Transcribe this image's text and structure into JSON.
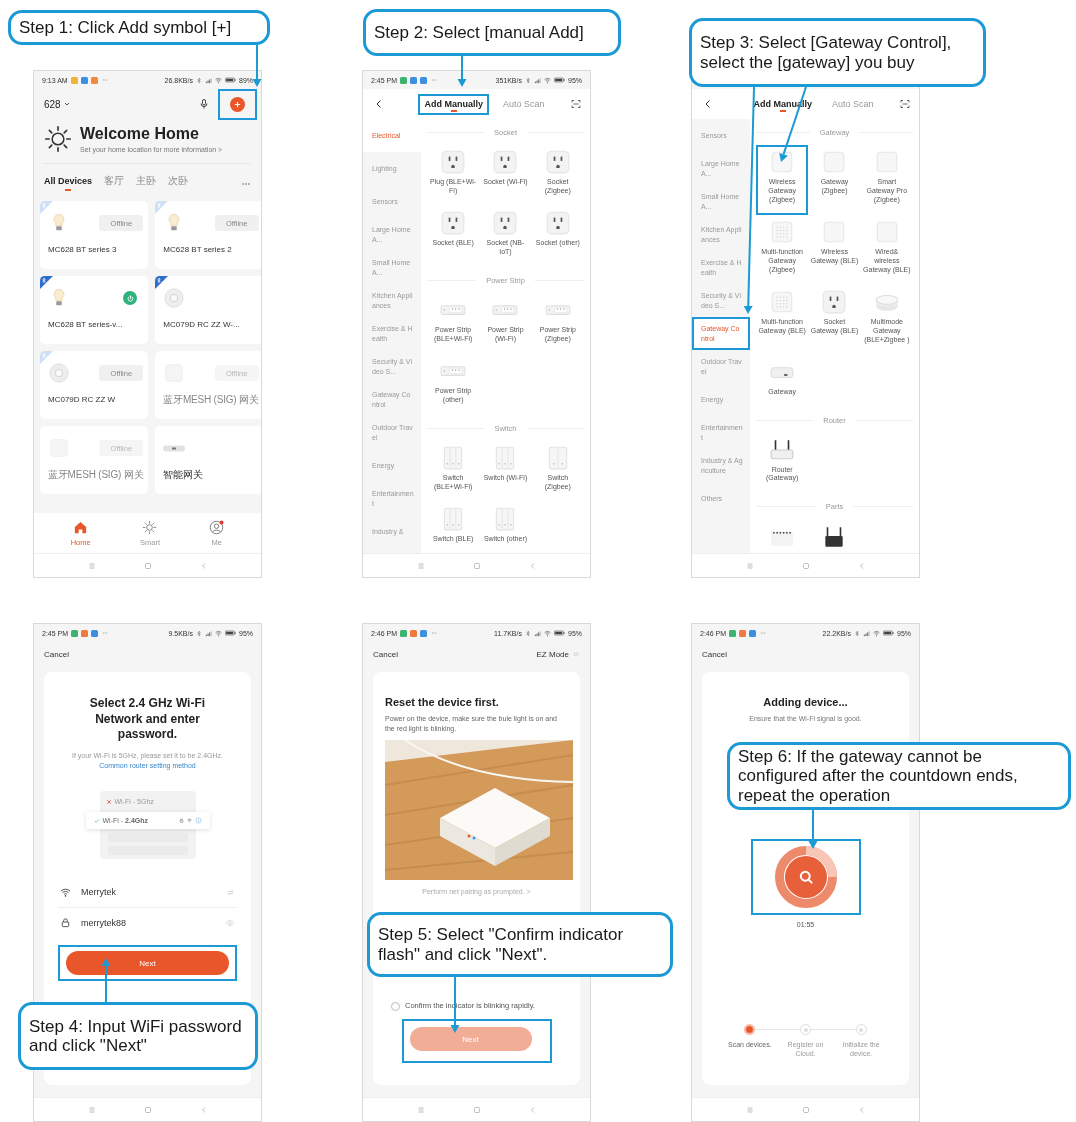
{
  "panels": [
    {
      "kind": "home",
      "callout": "Step 1: Click Add symbol [+]",
      "status": {
        "time": "9:13 AM",
        "apps": [
          {
            "color": "#f0b43c"
          },
          {
            "color": "#3d8fe0"
          },
          {
            "color": "#f08a3c"
          }
        ],
        "speed": "26.8KB/s",
        "battery": "89%"
      },
      "home_name": "628",
      "add_highlighted": true,
      "welcome": {
        "title": "Welcome Home",
        "subtitle": "Set your home location for more information >"
      },
      "rooms": [
        {
          "label": "All Devices",
          "selected": true
        },
        {
          "label": "客厅",
          "selected": false
        },
        {
          "label": "主卧",
          "selected": false
        },
        {
          "label": "次卧",
          "selected": false
        }
      ],
      "devices": [
        {
          "name": "MC628 BT series 3",
          "kind": "bulb",
          "bluetooth": true,
          "online": false,
          "status": "Offline",
          "power": false,
          "dimmed": false
        },
        {
          "name": "MC628 BT series 2",
          "kind": "bulb",
          "bluetooth": true,
          "online": false,
          "status": "Offline",
          "power": false,
          "dimmed": false
        },
        {
          "name": "MC628 BT series-v...",
          "kind": "bulb",
          "bluetooth": true,
          "online": true,
          "power": true,
          "dimmed": false
        },
        {
          "name": "MC079D RC ZZ W-...",
          "kind": "disc",
          "bluetooth": true,
          "online": true,
          "power": false,
          "dimmed": false
        },
        {
          "name": "MC079D RC ZZ W",
          "kind": "disc",
          "bluetooth": true,
          "online": false,
          "status": "Offline",
          "power": false,
          "dimmed": false
        },
        {
          "name": "蓝牙MESH (SIG) 网关",
          "kind": "box",
          "bluetooth": false,
          "status": "Offline",
          "power": false,
          "dimmed": true
        },
        {
          "name": "蓝牙MESH (SIG) 网关",
          "kind": "box",
          "bluetooth": false,
          "status": "Offline",
          "power": false,
          "dimmed": true
        },
        {
          "name": "智能网关",
          "kind": "hub",
          "bluetooth": false,
          "power": false,
          "dimmed": false
        }
      ],
      "nav": [
        {
          "label": "Home",
          "kind": "home",
          "selected": true,
          "badge": false
        },
        {
          "label": "Smart",
          "kind": "sun",
          "selected": false,
          "badge": false
        },
        {
          "label": "Me",
          "kind": "person",
          "selected": false,
          "badge": true
        }
      ]
    },
    {
      "kind": "catalog",
      "callout": "Step 2: Select [manual Add]",
      "status": {
        "time": "2:45 PM",
        "apps": [
          {
            "color": "#3cb371"
          },
          {
            "color": "#3d8fe0"
          },
          {
            "color": "#3d8fe0"
          }
        ],
        "speed": "351KB/s",
        "battery": "95%"
      },
      "tabs": [
        {
          "label": "Add Manually",
          "selected": true,
          "highlighted": true
        },
        {
          "label": "Auto Scan",
          "selected": false,
          "highlighted": false
        }
      ],
      "categories": [
        {
          "label": "Electrical",
          "selected": true,
          "highlighted": false
        },
        {
          "label": "Lighting",
          "selected": false,
          "highlighted": false
        },
        {
          "label": "Sensors",
          "selected": false,
          "highlighted": false
        },
        {
          "label": "Large Home A...",
          "selected": false,
          "highlighted": false
        },
        {
          "label": "Small Home A...",
          "selected": false,
          "highlighted": false
        },
        {
          "label": "Kitchen Appliances",
          "selected": false,
          "highlighted": false
        },
        {
          "label": "Exercise & Health",
          "selected": false,
          "highlighted": false
        },
        {
          "label": "Security & Video S...",
          "selected": false,
          "highlighted": false
        },
        {
          "label": "Gateway Control",
          "selected": false,
          "highlighted": false
        },
        {
          "label": "Outdoor Travel",
          "selected": false,
          "highlighted": false
        },
        {
          "label": "Energy",
          "selected": false,
          "highlighted": false
        },
        {
          "label": "Entertainment",
          "selected": false,
          "highlighted": false
        },
        {
          "label": "Industry &",
          "selected": false,
          "highlighted": false
        }
      ],
      "sections": [
        {
          "title": "Socket",
          "items": [
            {
              "label": "Plug (BLE+Wi-Fi)",
              "kind": "socket",
              "highlighted": false
            },
            {
              "label": "Socket (Wi-Fi)",
              "kind": "socket",
              "highlighted": false
            },
            {
              "label": "Socket (Zigbee)",
              "kind": "socket",
              "highlighted": false
            },
            {
              "label": "Socket (BLE)",
              "kind": "socket",
              "highlighted": false
            },
            {
              "label": "Socket (NB-IoT)",
              "kind": "socket",
              "highlighted": false
            },
            {
              "label": "Socket (other)",
              "kind": "socket",
              "highlighted": false
            }
          ]
        },
        {
          "title": "Power Strip",
          "items": [
            {
              "label": "Power Strip (BLE+Wi-Fi)",
              "kind": "strip",
              "highlighted": false
            },
            {
              "label": "Power Strip (Wi-Fi)",
              "kind": "strip",
              "highlighted": false
            },
            {
              "label": "Power Strip (Zigbee)",
              "kind": "strip",
              "highlighted": false
            },
            {
              "label": "Power Strip (other)",
              "kind": "strip",
              "highlighted": false
            }
          ]
        },
        {
          "title": "Switch",
          "items": [
            {
              "label": "Switch (BLE+Wi-Fi)",
              "kind": "switch3",
              "highlighted": false
            },
            {
              "label": "Switch (Wi-Fi)",
              "kind": "switch3",
              "highlighted": false
            },
            {
              "label": "Switch (Zigbee)",
              "kind": "switch2",
              "highlighted": false
            },
            {
              "label": "Switch (BLE)",
              "kind": "switch3",
              "highlighted": false
            },
            {
              "label": "Switch (other)",
              "kind": "switch3",
              "highlighted": false
            }
          ]
        }
      ]
    },
    {
      "kind": "catalog",
      "callout": "Step 3: Select [Gateway Control], select the [gateway] you buy",
      "tabs": [
        {
          "label": "Add Manually",
          "selected": true,
          "highlighted": false
        },
        {
          "label": "Auto Scan",
          "selected": false,
          "highlighted": false
        }
      ],
      "categories": [
        {
          "label": "Sensors",
          "selected": false,
          "highlighted": false
        },
        {
          "label": "Large Home A...",
          "selected": false,
          "highlighted": false
        },
        {
          "label": "Small Home A...",
          "selected": false,
          "highlighted": false
        },
        {
          "label": "Kitchen Appliances",
          "selected": false,
          "highlighted": false
        },
        {
          "label": "Exercise & Health",
          "selected": false,
          "highlighted": false
        },
        {
          "label": "Security & Video S...",
          "selected": false,
          "highlighted": false
        },
        {
          "label": "Gateway Control",
          "selected": true,
          "highlighted": true
        },
        {
          "label": "Outdoor Travel",
          "selected": false,
          "highlighted": false
        },
        {
          "label": "Energy",
          "selected": false,
          "highlighted": false
        },
        {
          "label": "Entertainment",
          "selected": false,
          "highlighted": false
        },
        {
          "label": "Industry & Agriculture",
          "selected": false,
          "highlighted": false
        },
        {
          "label": "Others",
          "selected": false,
          "highlighted": false
        }
      ],
      "sections": [
        {
          "title": "Gateway",
          "items": [
            {
              "label": "Wireless Gateway (Zigbee)",
              "kind": "gw-square",
              "highlighted": true
            },
            {
              "label": "Gateway (Zigbee)",
              "kind": "gw-square",
              "highlighted": false
            },
            {
              "label": "Smart Gateway Pro (Zigbee)",
              "kind": "gw-square",
              "highlighted": false
            },
            {
              "label": "Multi-function Gateway (Zigbee)",
              "kind": "gw-grid",
              "highlighted": false
            },
            {
              "label": "Wireless Gateway (BLE)",
              "kind": "gw-square",
              "highlighted": false
            },
            {
              "label": "Wired& wireless Gateway (BLE)",
              "kind": "gw-square",
              "highlighted": false
            },
            {
              "label": "Multi-function Gateway (BLE)",
              "kind": "gw-grid",
              "highlighted": false
            },
            {
              "label": "Socket Gateway (BLE)",
              "kind": "socket",
              "highlighted": false
            },
            {
              "label": "Multimode Gateway (BLE+Zigbee )",
              "kind": "gw-puck",
              "highlighted": false
            },
            {
              "label": "Gateway",
              "kind": "gw-flat",
              "highlighted": false
            }
          ]
        },
        {
          "title": "Router",
          "items": [
            {
              "label": "Router (Gateway)",
              "kind": "router",
              "highlighted": false
            }
          ]
        },
        {
          "title": "Parts",
          "items": [
            {
              "kind": "parts-strip",
              "highlighted": false
            },
            {
              "kind": "parts-router",
              "highlighted": false
            }
          ]
        }
      ]
    },
    {
      "kind": "wifi",
      "callout": "Step 4: Input WiFi password and click \"Next\"",
      "status": {
        "time": "2:45 PM",
        "apps": [
          {
            "color": "#3cb371"
          },
          {
            "color": "#f07a3c"
          },
          {
            "color": "#3d8fe0"
          }
        ],
        "speed": "9.5KB/s",
        "battery": "95%"
      },
      "cancel": "Cancel",
      "title": "Select 2.4 GHz Wi-Fi Network and enter password.",
      "hint": "If your Wi-Fi is 5GHz, please set it to be 2.4GHz.",
      "hint_link": "Common router setting method",
      "networks": [
        {
          "label": "Wi-Fi - 5Ghz",
          "ok": false
        },
        {
          "label": "Wi-Fi - **2.4Ghz**",
          "ok": true
        }
      ],
      "ssid": "Merrytek",
      "password": "merrytek88",
      "next": {
        "label": "Next",
        "disabled": false,
        "highlighted": true
      }
    },
    {
      "kind": "reset",
      "callout": "Step 5: Select \"Confirm indicator flash\" and click \"Next\".",
      "status": {
        "time": "2:46 PM",
        "apps": [
          {
            "color": "#3cb371"
          },
          {
            "color": "#f07a3c"
          },
          {
            "color": "#3d8fe0"
          }
        ],
        "speed": "11.7KB/s",
        "battery": "95%"
      },
      "cancel": "Cancel",
      "mode": "EZ Mode",
      "title": "Reset the device first.",
      "body": "Power on the device, make sure the bule light is on and the red light is blinking.",
      "prompt_link": "Perform net pairing as prompted. >",
      "confirm": {
        "label": "Confirm the indicator is blinking rapidly.",
        "checked": false
      },
      "next": {
        "label": "Next",
        "disabled": true,
        "highlighted": true
      }
    },
    {
      "kind": "adding",
      "callout": "Step 6: If the gateway cannot be configured after the countdown ends, repeat the operation",
      "status": {
        "time": "2:46 PM",
        "apps": [
          {
            "color": "#3cb371"
          },
          {
            "color": "#f07a3c"
          },
          {
            "color": "#3d8fe0"
          }
        ],
        "speed": "22.2KB/s",
        "battery": "95%"
      },
      "cancel": "Cancel",
      "title": "Adding device...",
      "subtitle": "Ensure that the Wi-Fi signal is good.",
      "ring": {
        "highlighted": true
      },
      "countdown": "01:55",
      "steps": [
        {
          "label": "Scan devices.",
          "active": true
        },
        {
          "label": "Register on Cloud.",
          "active": false
        },
        {
          "label": "Initialize the device.",
          "active": false
        }
      ]
    }
  ]
}
